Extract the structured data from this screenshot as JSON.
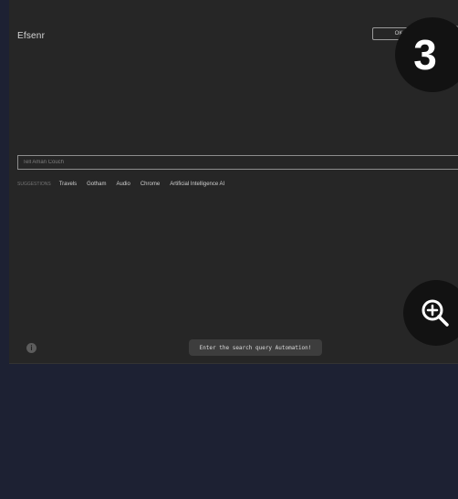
{
  "app": {
    "logo_text": "Efsenr"
  },
  "header": {
    "action_button": "OK"
  },
  "search": {
    "placeholder": "Tell Aman Couch",
    "value": ""
  },
  "suggestions": {
    "label": "SUGGESTIONS",
    "items": [
      "Travels",
      "Gotham",
      "Audio",
      "Chrome",
      "Artificial Intelligence AI"
    ]
  },
  "footer": {
    "info_glyph": "i"
  },
  "tooltip": {
    "text": "Enter the search query Automation!"
  },
  "overlay": {
    "step_number": "3"
  },
  "icons": [
    "info-icon",
    "zoom-in-icon"
  ]
}
